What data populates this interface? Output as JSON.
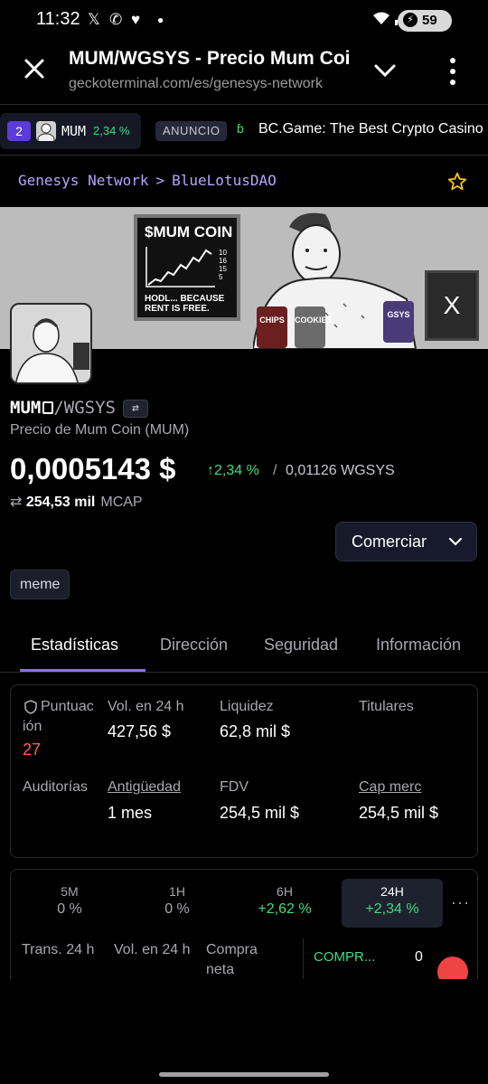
{
  "status_bar": {
    "time": "11:32",
    "battery": "59"
  },
  "browser": {
    "title": "MUM/WGSYS - Precio Mum Coin",
    "url": "geckoterminal.com/es/genesys-network"
  },
  "ticker": {
    "rank": "2",
    "symbol": "MUM",
    "change": "2,34 %",
    "ad_label": "ANUNCIO",
    "ad_text": "BC.Game: The Best Crypto Casino"
  },
  "breadcrumb": {
    "network": "Genesys Network",
    "separator": ">",
    "dex": "BlueLotusDAO"
  },
  "banner": {
    "board_title": "$MUM COIN",
    "board_numbers": [
      "10",
      "16",
      "15",
      "5"
    ],
    "board_note": "HODL... BECAUSE RENT IS FREE.",
    "bag_chips": "CHIPS",
    "bag_cookies": "COOKIES",
    "bag_gsys": "GSYS",
    "monitor_logo": "X"
  },
  "token": {
    "base": "MUM",
    "quote": "/WGSYS",
    "subtitle": "Precio de Mum Coin (MUM)",
    "price": "0,0005143 $",
    "change": "2,34 %",
    "slash": "/",
    "price_alt": "0,01126 WGSYS",
    "mcap_value": "254,53 mil",
    "mcap_label": "MCAP",
    "trade_label": "Comerciar",
    "tag": "meme"
  },
  "tabs": [
    "Estadísticas",
    "Dirección",
    "Seguridad",
    "Información"
  ],
  "stats": {
    "score_label_1": "Puntuac",
    "score_label_2": "ión",
    "score_value": "27",
    "vol_label": "Vol. en 24 h",
    "vol_value": "427,56 $",
    "liq_label": "Liquidez",
    "liq_value": "62,8 mil $",
    "holders_label": "Titulares",
    "audits_label": "Auditorías",
    "age_label": "Antigüedad",
    "age_value": "1 mes",
    "fdv_label": "FDV",
    "fdv_value": "254,5 mil $",
    "mcap_label": "Cap merc",
    "mcap_value": "254,5 mil $"
  },
  "timeframes": [
    {
      "key": "5M",
      "value": "0 %"
    },
    {
      "key": "1H",
      "value": "0 %"
    },
    {
      "key": "6H",
      "value": "+2,62 %"
    },
    {
      "key": "24H",
      "value": "+2,34 %"
    }
  ],
  "more_label": "···",
  "bottom": {
    "tx_label": "Trans. 24 h",
    "vol_label": "Vol. en 24 h",
    "net_label_1": "Compra",
    "net_label_2": "neta",
    "buys_label": "COMPR...",
    "buys_value": "0"
  },
  "colors": {
    "accent": "#8b6cff",
    "positive": "#3ddc84",
    "negative": "#ff5b5b",
    "breadcrumb": "#b9a4ff"
  }
}
